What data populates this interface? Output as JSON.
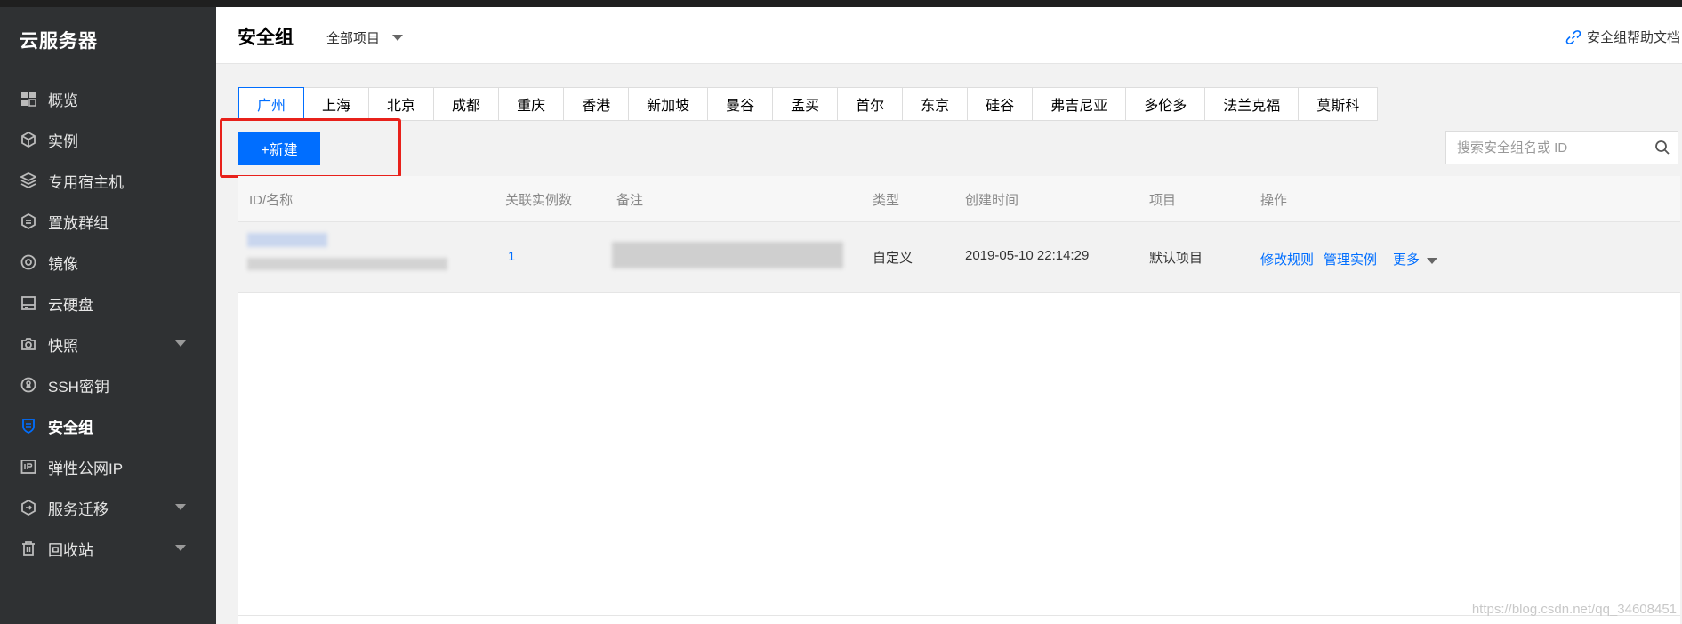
{
  "app": {
    "brand": "云服务器"
  },
  "sidebar": {
    "items": [
      {
        "label": "概览",
        "icon": "overview-icon"
      },
      {
        "label": "实例",
        "icon": "instance-icon"
      },
      {
        "label": "专用宿主机",
        "icon": "host-icon"
      },
      {
        "label": "置放群组",
        "icon": "placement-icon"
      },
      {
        "label": "镜像",
        "icon": "image-icon"
      },
      {
        "label": "云硬盘",
        "icon": "disk-icon"
      },
      {
        "label": "快照",
        "icon": "camera-icon",
        "has_caret": true
      },
      {
        "label": "SSH密钥",
        "icon": "key-icon"
      },
      {
        "label": "安全组",
        "icon": "shield-icon",
        "active": true
      },
      {
        "label": "弹性公网IP",
        "icon": "ip-icon"
      },
      {
        "label": "服务迁移",
        "icon": "migrate-icon",
        "has_caret": true
      },
      {
        "label": "回收站",
        "icon": "trash-icon",
        "has_caret": true
      }
    ]
  },
  "header": {
    "title": "安全组",
    "project_select": "全部项目",
    "help_link": "安全组帮助文档"
  },
  "regions": {
    "tabs": [
      "广州",
      "上海",
      "北京",
      "成都",
      "重庆",
      "香港",
      "新加坡",
      "曼谷",
      "孟买",
      "首尔",
      "东京",
      "硅谷",
      "弗吉尼亚",
      "多伦多",
      "法兰克福",
      "莫斯科"
    ],
    "active": "广州"
  },
  "toolbar": {
    "new_label": "+新建",
    "search_placeholder": "搜索安全组名或 ID"
  },
  "table": {
    "columns": [
      "ID/名称",
      "关联实例数",
      "备注",
      "类型",
      "创建时间",
      "项目",
      "操作"
    ],
    "rows": [
      {
        "linked_instances": "1",
        "type": "自定义",
        "created": "2019-05-10 22:14:29",
        "project": "默认项目",
        "actions": [
          "修改规则",
          "管理实例",
          "更多"
        ]
      }
    ]
  },
  "watermark": "https://blog.csdn.net/qq_34608451",
  "colors": {
    "accent": "#006eff",
    "sidebar_bg": "#2f3133",
    "highlight_box": "#e8211b"
  }
}
